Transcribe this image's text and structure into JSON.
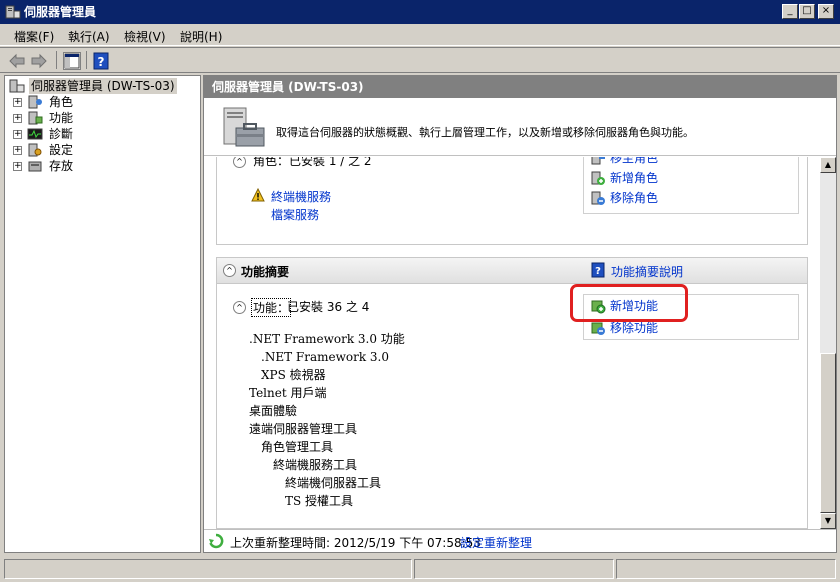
{
  "window": {
    "title": "伺服器管理員"
  },
  "titlebar_buttons": [
    "_",
    "□",
    "×"
  ],
  "menu": [
    "檔案(F)",
    "執行(A)",
    "檢視(V)",
    "說明(H)"
  ],
  "toolbar": {
    "icons": [
      "back-arrow-icon",
      "forward-arrow-icon",
      "show-hide-console-tree-icon",
      "help-icon"
    ]
  },
  "tree": {
    "root": "伺服器管理員 (DW-TS-03)",
    "items": [
      {
        "label": "角色",
        "icon": "roles-icon"
      },
      {
        "label": "功能",
        "icon": "features-icon"
      },
      {
        "label": "診斷",
        "icon": "diagnostics-icon"
      },
      {
        "label": "設定",
        "icon": "configuration-icon"
      },
      {
        "label": "存放",
        "icon": "storage-icon"
      }
    ]
  },
  "main": {
    "header": "伺服器管理員 (DW-TS-03)",
    "banner_text": "取得這台伺服器的狀態概觀、執行上層管理工作，以及新增或移除伺服器角色與功能。",
    "roles_section": {
      "partial_heading": "角色：已安裝 1 / 之 2",
      "warning_link": "終端機服務",
      "link2": "檔案服務",
      "tasks": [
        "移至角色",
        "新增角色",
        "移除角色"
      ]
    },
    "features_section": {
      "title": "功能摘要",
      "help_link": "功能摘要說明",
      "sub_label": "功能：",
      "sub_count": "已安裝 36 之 4",
      "tasks": [
        "新增功能",
        "移除功能"
      ],
      "features": [
        {
          "text": ".NET Framework 3.0 功能",
          "indent": 0
        },
        {
          "text": ".NET Framework 3.0",
          "indent": 1
        },
        {
          "text": "XPS 檢視器",
          "indent": 1
        },
        {
          "text": "Telnet 用戶端",
          "indent": 0
        },
        {
          "text": "桌面體驗",
          "indent": 0
        },
        {
          "text": "遠端伺服器管理工具",
          "indent": 0
        },
        {
          "text": "角色管理工具",
          "indent": 1
        },
        {
          "text": "終端機服務工具",
          "indent": 2
        },
        {
          "text": "終端機伺服器工具",
          "indent": 3
        },
        {
          "text": "TS 授權工具",
          "indent": 3
        }
      ]
    },
    "footer": {
      "refresh_text": "上次重新整理時間: 2012/5/19 下午 07:58:53",
      "configure_link": "設定重新整理"
    }
  },
  "colors": {
    "titlebar": "#0a246a",
    "link": "#0033cc",
    "highlight": "#e02020",
    "header_gray": "#808080"
  }
}
